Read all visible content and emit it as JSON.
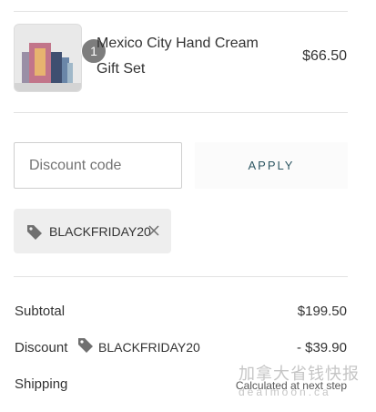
{
  "line_item": {
    "quantity": "1",
    "name": "Mexico City Hand Cream Gift Set",
    "price": "$66.50"
  },
  "discount": {
    "placeholder": "Discount code",
    "apply_label": "APPLY",
    "applied_code": "BLACKFRIDAY20"
  },
  "summary": {
    "subtotal_label": "Subtotal",
    "subtotal_value": "$199.50",
    "discount_label": "Discount",
    "discount_code": "BLACKFRIDAY20",
    "discount_value": "- $39.90",
    "shipping_label": "Shipping",
    "shipping_value": "Calculated at next step"
  },
  "watermark": {
    "text": "加拿大省钱快报",
    "sub": "dealmoon.ca"
  },
  "colors": {
    "apply_text": "#2d5662",
    "chip_bg": "#eeeeee",
    "qty_badge": "#7d7d7d"
  }
}
